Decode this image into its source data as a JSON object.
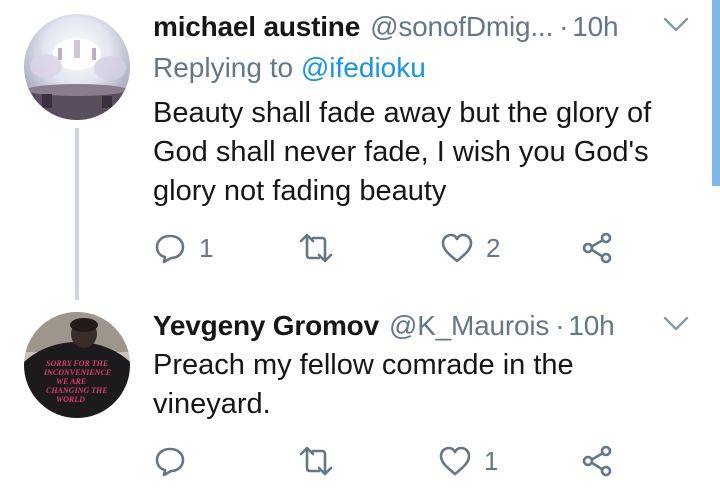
{
  "colors": {
    "text": "#14171a",
    "secondary": "#657786",
    "link": "#1b95e0",
    "thread_line": "#ccd6dd",
    "scrollbar": "#7fb6e8"
  },
  "tweets": [
    {
      "name": "michael austine",
      "handle": "@sonofDmig...",
      "separator": "·",
      "time": "10h",
      "replying_label": "Replying to",
      "replying_to": "@ifedioku",
      "lines": [
        "Beauty shall fade away but the glory of",
        "God shall never fade, I wish you God's",
        "glory not fading beauty"
      ],
      "reply_count": "1",
      "retweet_count": "",
      "like_count": "2"
    },
    {
      "name": "Yevgeny Gromov",
      "handle": "@K_Maurois",
      "separator": "·",
      "time": "10h",
      "avatar_shirt_text": [
        "SORRY FOR THE",
        "INCONVENIENCE",
        "WE ARE",
        "CHANGING THE",
        "WORLD"
      ],
      "lines": [
        "Preach my fellow comrade in the",
        "vineyard."
      ],
      "reply_count": "",
      "retweet_count": "",
      "like_count": "1"
    }
  ]
}
